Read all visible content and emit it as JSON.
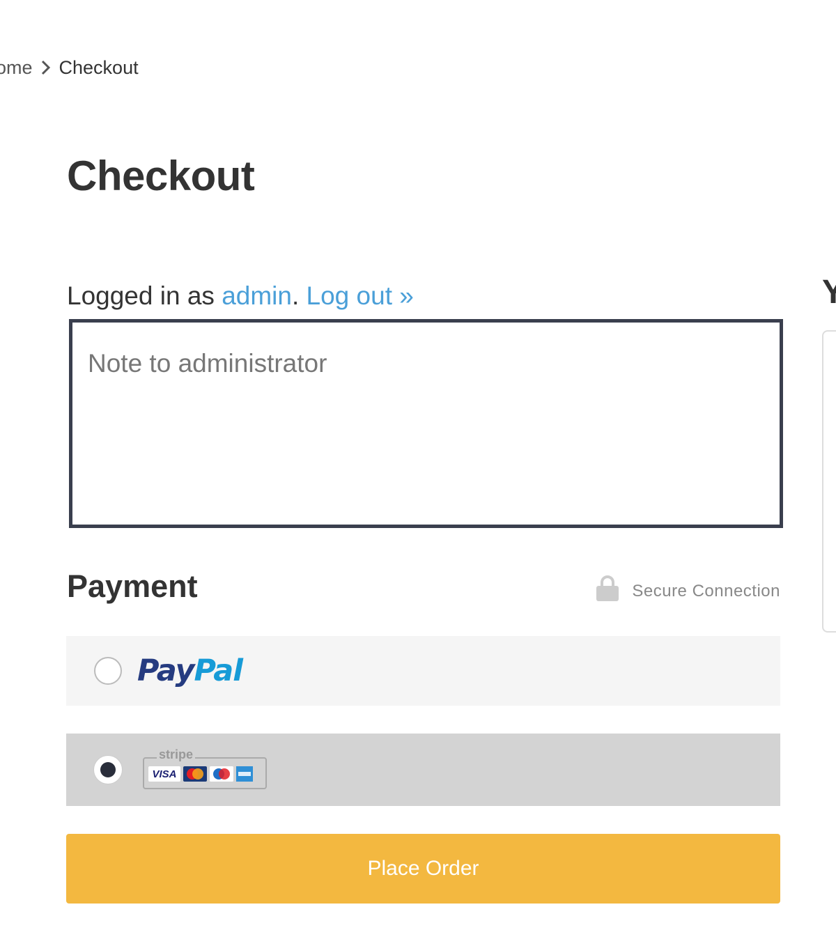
{
  "breadcrumb": {
    "home_label": "ome",
    "separator_icon": "chevron-right-icon",
    "current_label": "Checkout"
  },
  "page": {
    "title": "Checkout"
  },
  "login": {
    "prefix": "Logged in as ",
    "username": "admin",
    "separator": ". ",
    "logout_label": "Log out »"
  },
  "note": {
    "value": "",
    "placeholder": "Note to administrator"
  },
  "payment": {
    "title": "Payment",
    "secure_label": "Secure Connection",
    "secure_icon": "lock-icon",
    "options": [
      {
        "id": "paypal",
        "label_part1": "Pay",
        "label_part2": "Pal",
        "selected": false
      },
      {
        "id": "stripe",
        "badge_word": "stripe",
        "cards": [
          "VISA",
          "MasterCard",
          "Maestro",
          "American Express"
        ],
        "selected": true
      }
    ]
  },
  "order": {
    "place_order_label": "Place Order"
  },
  "sidebar": {
    "heading_partial": "Y"
  },
  "colors": {
    "link": "#4a9fd8",
    "button": "#f3b840",
    "note_border": "#3a3f4e",
    "paypal_dark": "#253b80",
    "paypal_light": "#179bd7"
  }
}
